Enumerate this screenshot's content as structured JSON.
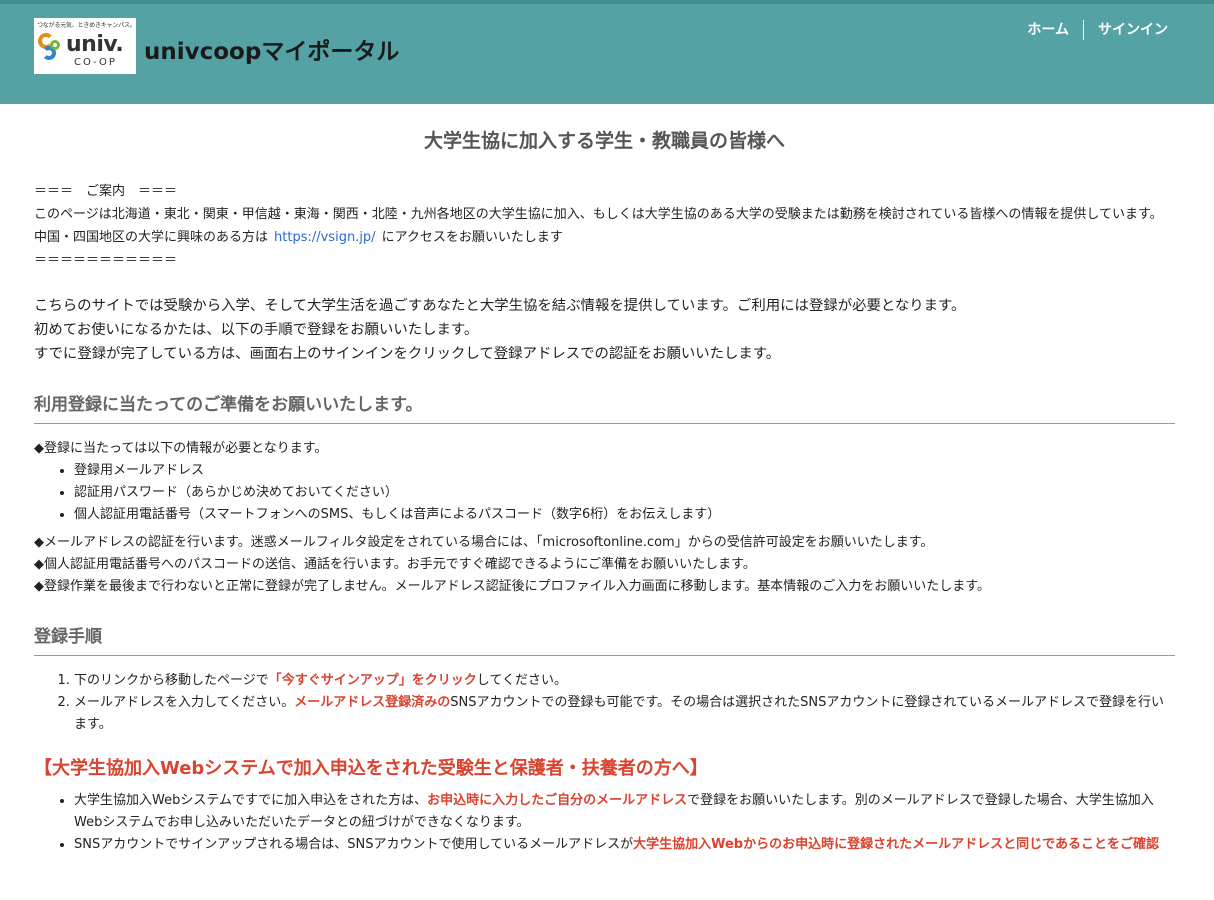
{
  "header": {
    "logo_tagline": "つながる元気、ときめきキャンパス。",
    "logo_univ": "univ.",
    "logo_coop": "CO-OP",
    "site_title": "univcoopマイポータル",
    "nav_home": "ホーム",
    "nav_signin": "サインイン"
  },
  "colors": {
    "header_bg": "#54a2a3",
    "accent_red": "#d9432f",
    "link_blue": "#2a6bd0"
  },
  "main": {
    "page_title": "大学生協に加入する学生・教職員の皆様へ",
    "notice": {
      "head": "＝＝＝　ご案内　＝＝＝",
      "line1": "このページは北海道・東北・関東・甲信越・東海・関西・北陸・九州各地区の大学生協に加入、もしくは大学生協のある大学の受験または勤務を検討されている皆様への情報を提供しています。",
      "line2_pre": "中国・四国地区の大学に興味のある方は",
      "line2_link": "https://vsign.jp/",
      "line2_post": "にアクセスをお願いいたします",
      "tail": "＝＝＝＝＝＝＝＝＝＝＝"
    },
    "intro": [
      "こちらのサイトでは受験から入学、そして大学生活を過ごすあなたと大学生協を結ぶ情報を提供しています。ご利用には登録が必要となります。",
      "初めてお使いになるかたは、以下の手順で登録をお願いいたします。",
      "すでに登録が完了している方は、画面右上のサインインをクリックして登録アドレスでの認証をお願いいたします。"
    ],
    "prep": {
      "title": "利用登録に当たってのご準備をお願いいたします。",
      "lead": "◆登録に当たっては以下の情報が必要となります。",
      "items": [
        "登録用メールアドレス",
        "認証用パスワード（あらかじめ決めておいてください）",
        "個人認証用電話番号（スマートフォンへのSMS、もしくは音声によるパスコード（数字6桁）をお伝えします）"
      ],
      "notes": [
        "◆メールアドレスの認証を行います。迷惑メールフィルタ設定をされている場合には、「microsoftonline.com」からの受信許可設定をお願いいたします。",
        "◆個人認証用電話番号へのパスコードの送信、通話を行います。お手元ですぐ確認できるようにご準備をお願いいたします。",
        "◆登録作業を最後まで行わないと正常に登録が完了しません。メールアドレス認証後にプロファイル入力画面に移動します。基本情報のご入力をお願いいたします。"
      ]
    },
    "steps": {
      "title": "登録手順",
      "s1_pre": "下のリンクから移動したページで",
      "s1_red": "「今すぐサインアップ」をクリック",
      "s1_post": "してください。",
      "s2_pre": "メールアドレスを入力してください。",
      "s2_red": "メールアドレス登録済みの",
      "s2_post": "SNSアカウントでの登録も可能です。その場合は選択されたSNSアカウントに登録されているメールアドレスで登録を行います。"
    },
    "examinees": {
      "title": "【大学生協加入Webシステムで加入申込をされた受験生と保護者・扶養者の方へ】",
      "b1_pre": "大学生協加入Webシステムですでに加入申込をされた方は、",
      "b1_red": "お申込時に入力したご自分のメールアドレス",
      "b1_post": "で登録をお願いいたします。別のメールアドレスで登録した場合、大学生協加入Webシステムでお申し込みいただいたデータとの紐づけができなくなります。",
      "b2_pre": "SNSアカウントでサインアップされる場合は、SNSアカウントで使用しているメールアドレスが",
      "b2_red": "大学生協加入Webからのお申込時に登録されたメールアドレスと同じであることをご確認"
    }
  }
}
